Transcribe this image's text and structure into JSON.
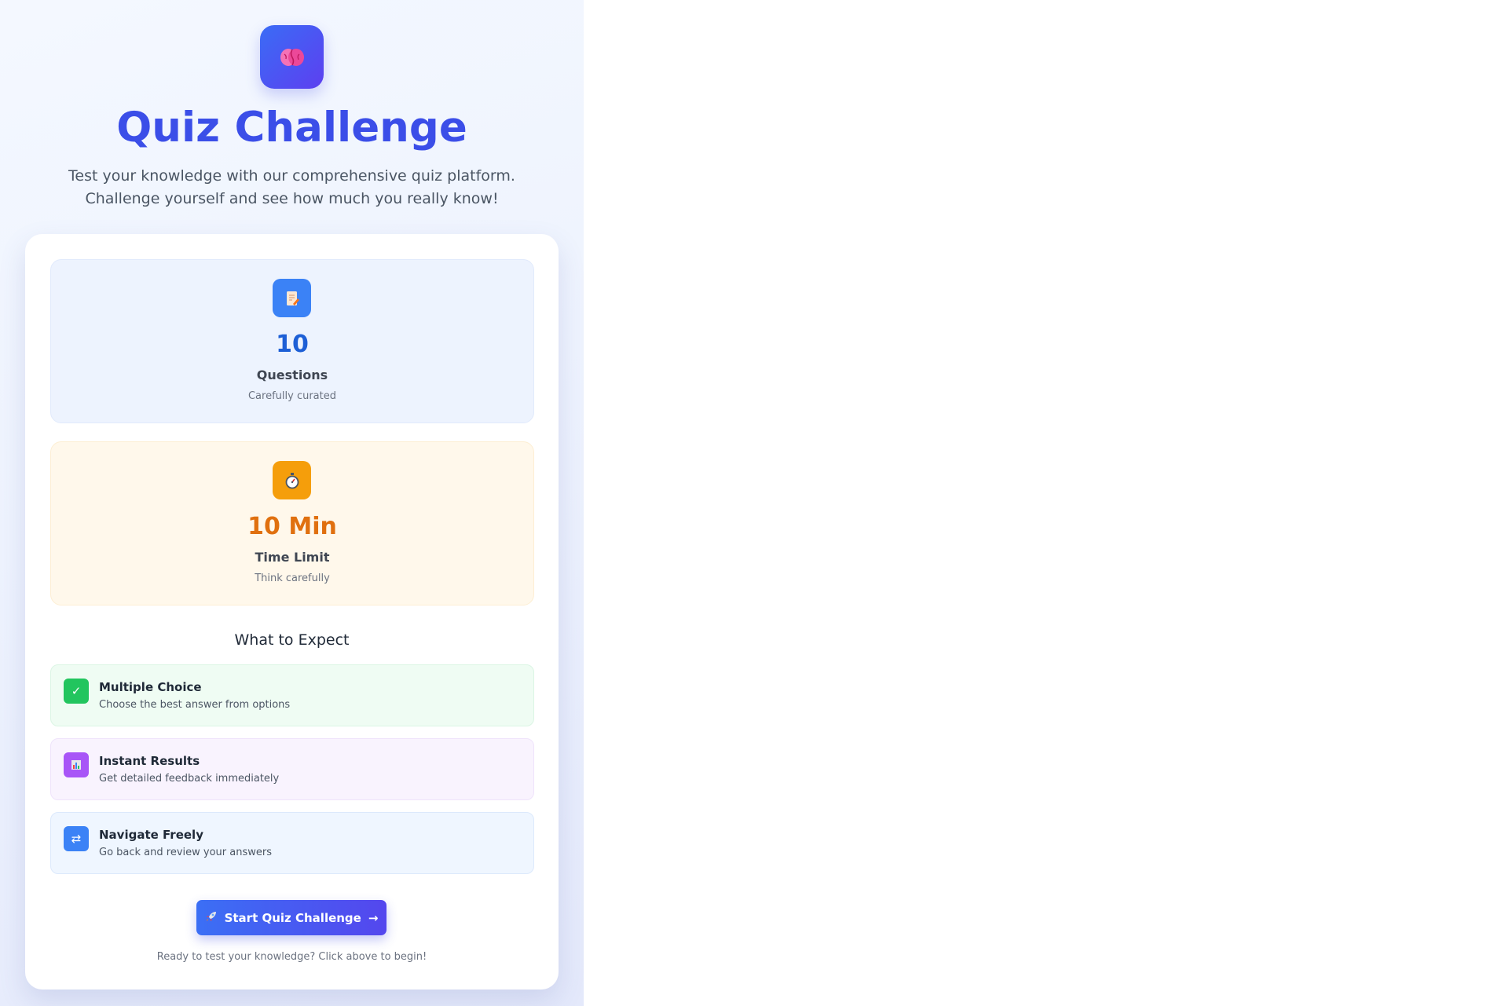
{
  "header": {
    "logo_icon": "brain-icon",
    "title": "Quiz Challenge",
    "subtitle": "Test your knowledge with our comprehensive quiz platform. Challenge yourself and see how much you really know!"
  },
  "stats": [
    {
      "icon": "memo-icon",
      "value": "10",
      "label": "Questions",
      "sub": "Carefully curated",
      "accent": "#3b82f6"
    },
    {
      "icon": "stopwatch-icon",
      "value": "10 Min",
      "label": "Time Limit",
      "sub": "Think carefully",
      "accent": "#f59e0b"
    }
  ],
  "expect": {
    "heading": "What to Expect",
    "items": [
      {
        "icon": "checkmark-icon",
        "glyph": "✓",
        "title": "Multiple Choice",
        "desc": "Choose the best answer from options",
        "accent": "#22c55e"
      },
      {
        "icon": "bar-chart-icon",
        "glyph": "",
        "title": "Instant Results",
        "desc": "Get detailed feedback immediately",
        "accent": "#a855f7"
      },
      {
        "icon": "swap-arrows-icon",
        "glyph": "⇄",
        "title": "Navigate Freely",
        "desc": "Go back and review your answers",
        "accent": "#3b82f6"
      }
    ]
  },
  "start": {
    "icon": "rocket-icon",
    "label": "Start Quiz Challenge",
    "arrow": "→",
    "hint": "Ready to test your knowledge? Click above to begin!"
  }
}
